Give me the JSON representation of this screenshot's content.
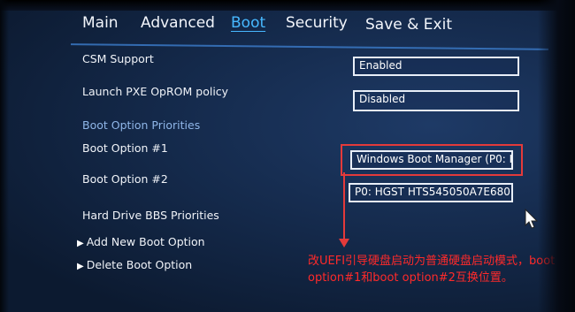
{
  "tabs": [
    {
      "label": "Main"
    },
    {
      "label": "Advanced"
    },
    {
      "label": "Boot"
    },
    {
      "label": "Security"
    },
    {
      "label": "Save & Exit"
    }
  ],
  "active_tab": "Boot",
  "settings": {
    "csm_support": {
      "label": "CSM Support",
      "value": "Enabled"
    },
    "launch_pxe": {
      "label": "Launch PXE OpROM policy",
      "value": "Disabled"
    },
    "section_title": "Boot Option Priorities",
    "boot_option_1": {
      "label": "Boot Option #1",
      "value": "Windows Boot Manager (P0: I"
    },
    "boot_option_2": {
      "label": "Boot Option #2",
      "value": "P0: HGST HTS545050A7E680"
    },
    "hard_drive_bbs": {
      "label": "Hard Drive BBS Priorities"
    },
    "add_new_boot": {
      "label": "Add New Boot Option"
    },
    "delete_boot": {
      "label": "Delete Boot Option"
    }
  },
  "annotation": {
    "text": "改UEFI引导硬盘启动为普通硬盘启动模式，boot option#1和boot option#2互换位置。",
    "color": "#ff2a2a"
  },
  "colors": {
    "background": "#14294a",
    "active_tab": "#47b8ff",
    "section": "#8fb6e8",
    "highlight": "#e43a3a"
  }
}
